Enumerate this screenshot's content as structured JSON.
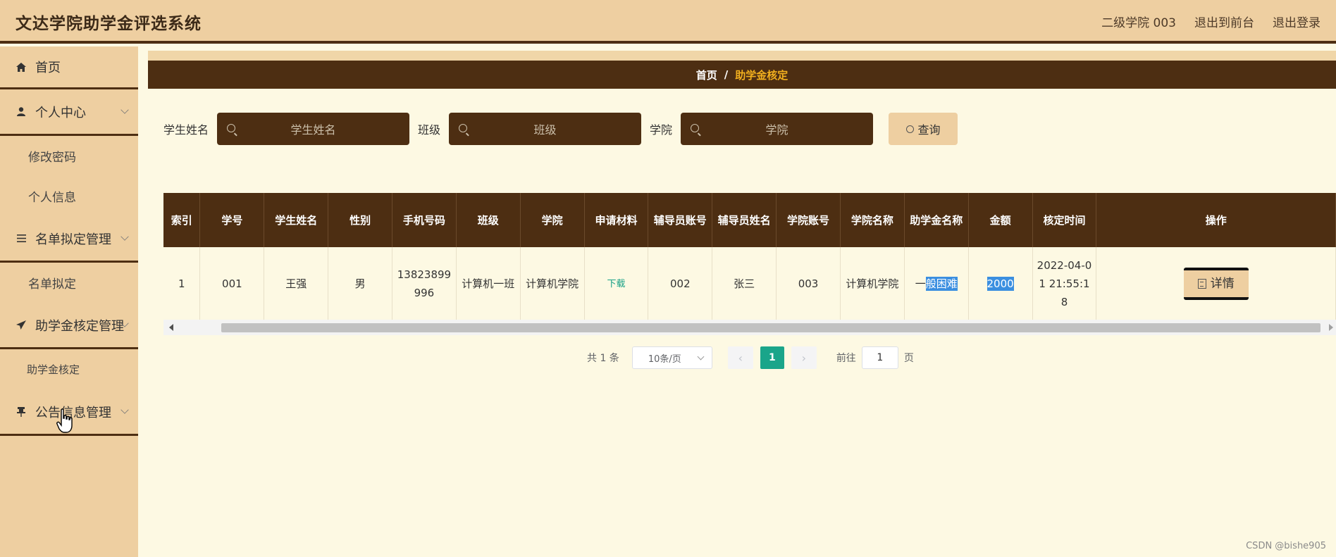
{
  "header": {
    "title": "文达学院助学金评选系统",
    "user": "二级学院 003",
    "to_front": "退出到前台",
    "logout": "退出登录"
  },
  "sidebar": {
    "home": "首页",
    "personal_center": "个人中心",
    "change_password": "修改密码",
    "personal_info": "个人信息",
    "list_mgmt": "名单拟定管理",
    "list_draft": "名单拟定",
    "grant_approval_mgmt": "助学金核定管理",
    "grant_approval": "助学金核定",
    "notice_mgmt": "公告信息管理"
  },
  "breadcrumb": {
    "home": "首页",
    "separator": "/",
    "current": "助学金核定"
  },
  "search": {
    "student_name_label": "学生姓名",
    "student_name_placeholder": "学生姓名",
    "class_label": "班级",
    "class_placeholder": "班级",
    "college_label": "学院",
    "college_placeholder": "学院",
    "query_label": "查询"
  },
  "table": {
    "headers": [
      "索引",
      "学号",
      "学生姓名",
      "性别",
      "手机号码",
      "班级",
      "学院",
      "申请材料",
      "辅导员账号",
      "辅导员姓名",
      "学院账号",
      "学院名称",
      "助学金名称",
      "金额",
      "核定时间",
      "操作"
    ],
    "rows": [
      {
        "index": "1",
        "student_id": "001",
        "name": "王强",
        "gender": "男",
        "phone": "13823899996",
        "class": "计算机一班",
        "college": "计算机学院",
        "material": "下载",
        "counselor_account": "002",
        "counselor_name": "张三",
        "college_account": "003",
        "college_name": "计算机学院",
        "grant_name_prefix": "一",
        "grant_name_highlight": "般困难",
        "amount": "2000",
        "approval_time": "2022-04-01 21:55:18",
        "action": "详情"
      }
    ]
  },
  "pagination": {
    "total": "共 1 条",
    "page_size": "10条/页",
    "prev": "‹",
    "current_page": "1",
    "next": "›",
    "goto_label": "前往",
    "goto_value": "1",
    "page_suffix": "页"
  },
  "watermark": "CSDN @bishe905"
}
